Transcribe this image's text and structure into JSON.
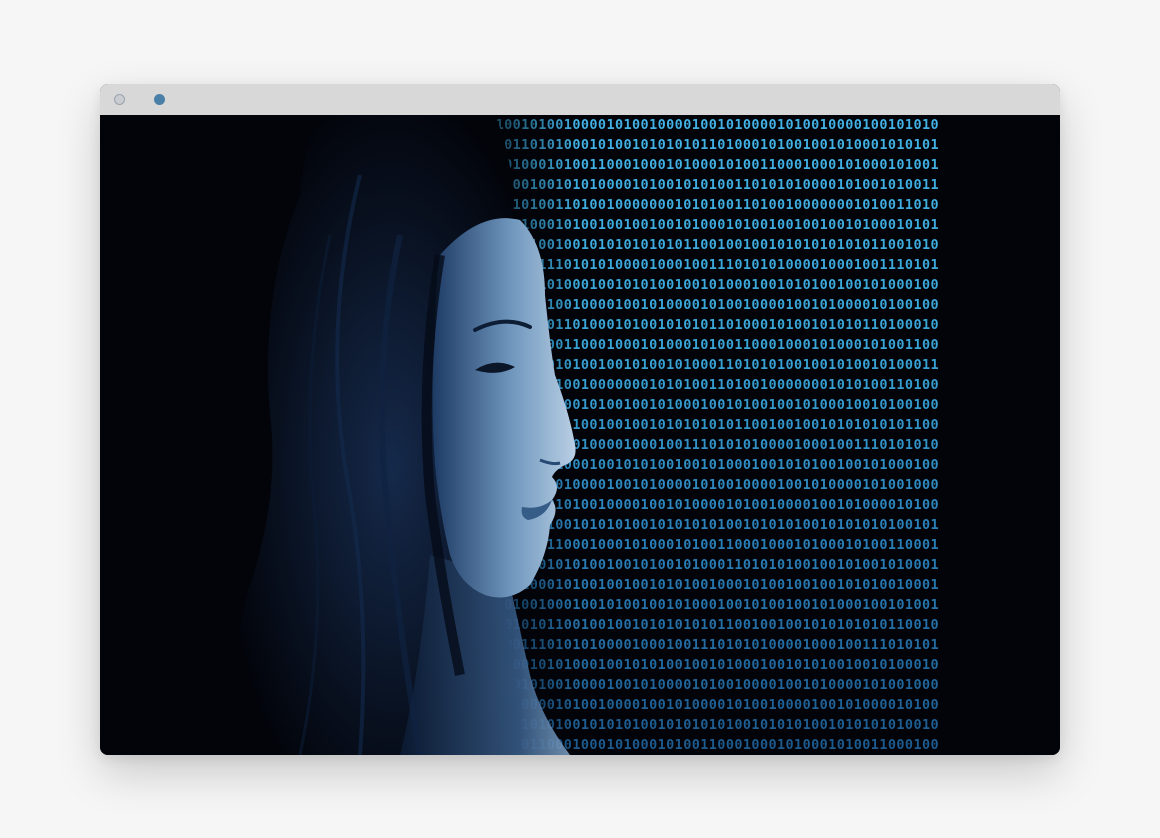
{
  "window": {
    "title_bar": {
      "controls": [
        {
          "name": "window-control-1",
          "color": "#c9ccd1"
        },
        {
          "name": "window-control-2",
          "color": "#4a7fa8"
        }
      ]
    }
  },
  "image": {
    "subject_icon": "profile-portrait",
    "binary_rows": [
      "1001001010010000101001000010010100001010010000100101010",
      "0101011010100010100101010101101000101001001010001010101",
      "0001010001010011000100010100010100110001000101000101001",
      "1101000100101010000101001010100110101010000101001010011",
      "0101010100110100100000001010100110100100000001010011010",
      "0100101000101001001001001010001010010010010010100010101",
      "0010101100100101010101010110010010010101010101011001010",
      "1010010011101010100001000100111010101000010001001110101",
      "1001010010100010010101001001010001001010100100101000100",
      "0100000101001000010010100001010010000100101000010100100",
      "1000101010110100010100101010110100010100101010110100010",
      "1010001010011000100010100010100110001000101000101001100",
      "0100011010101001001010010100011010101001001010010100011",
      "0101000110100100000001010100110100100000001010100110100",
      "0100101000100101001001010001001010010010100010010100100",
      "1010100101011001001001010101010110010010010101010101100",
      "0100011101010100001000100111010101000010001001110101010",
      "0101010010100010010101001001010001001010100100101000100",
      "0001001010010000100101000010100100001001010000101001000",
      "1001010000101001000010010100001010010000100101000010100",
      "0101010101001010101001010101010010101010010101010100101",
      "0010101001100010001010001010011000100010100010100110001",
      "1010001101010100100101001010001101010100100101001010001",
      "0101001000101001001001010100100010100100100101010010001",
      "1001010010001001010010010100010010100100101000100101001",
      "1010010101100100100101010101011001001001010101010110010",
      "0101001110101010000100010011101010100001000100111010101",
      "0100100101010001001010100100101000100101010010010100010",
      "1001001010010000100101000010100100001001010000101001000",
      "0101010000101001000010010100001010010000100101000010100",
      "1010101010100101010100101010101001010101001010101010010",
      "0010100110001000101000101001100010001010001010011000100",
      "1001101010100100101001010001101010100100101001010001101"
    ]
  }
}
